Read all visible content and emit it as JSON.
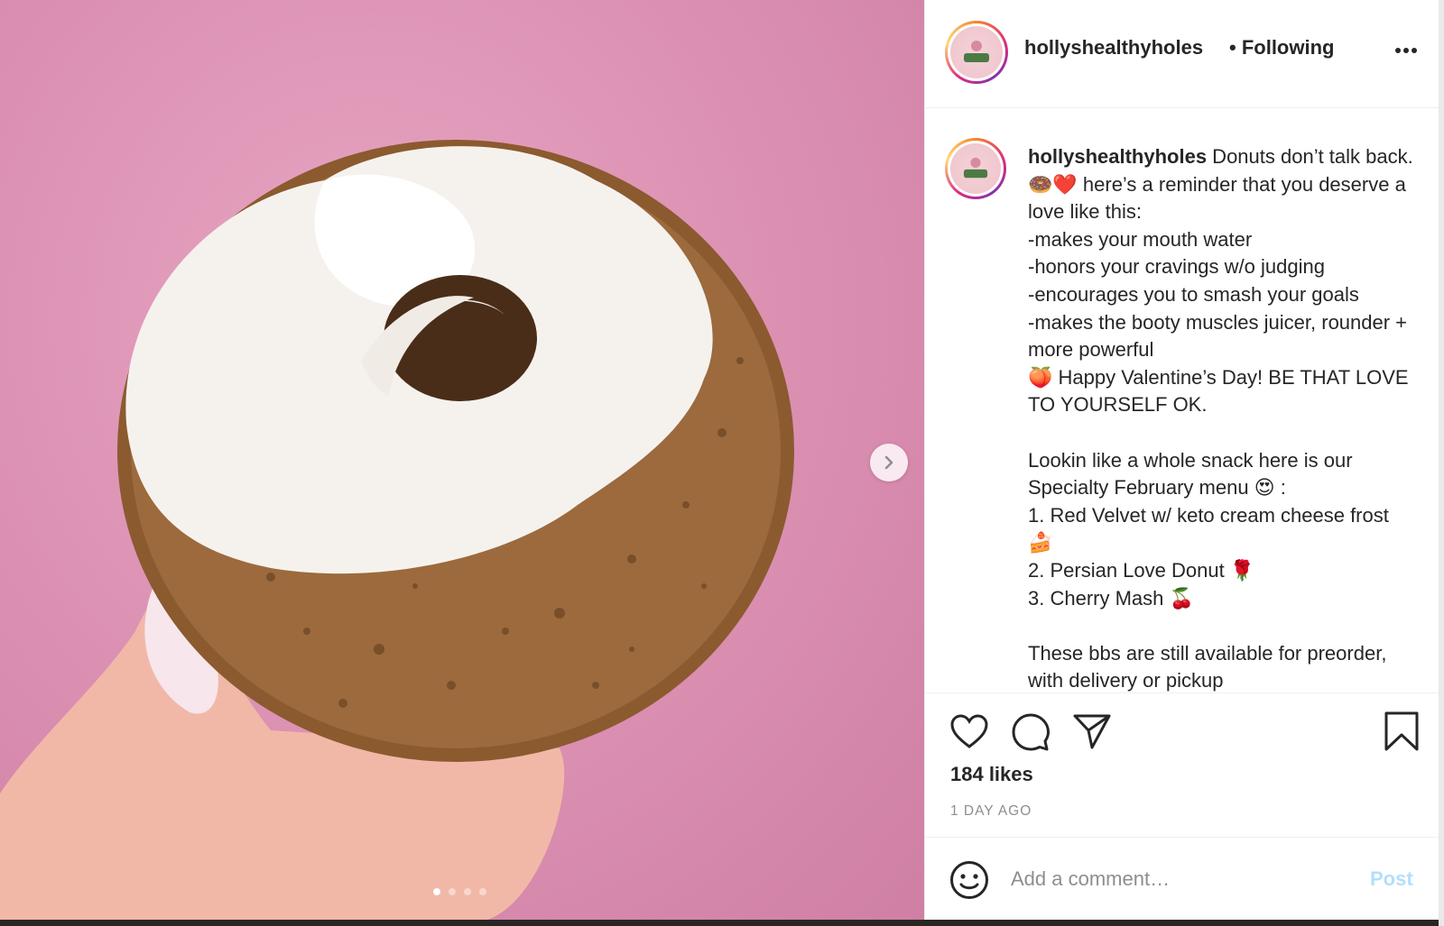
{
  "header": {
    "username": "hollyshealthyholes",
    "separator": "•",
    "follow_status": "Following",
    "more_icon": "more-horizontal-icon"
  },
  "media": {
    "image_description_icon": "donut-photo",
    "carousel": {
      "total": 4,
      "active": 1
    },
    "next_icon": "chevron-right-icon"
  },
  "caption": {
    "username": "hollyshealthyholes",
    "text": " Donuts don’t talk back. 🍩❤️ here’s a reminder that you deserve a love like this:\n-makes your mouth water\n-honors your cravings w/o judging\n-encourages you to smash your goals\n-makes the booty muscles juicer, rounder + more powerful\n🍑 Happy Valentine’s Day! BE THAT LOVE TO YOURSELF OK.\n\nLookin like a whole snack here is our Specialty February menu 😍 :\n1. Red Velvet w/ keto cream cheese frost 🍰\n2. Persian Love Donut 🌹\n3. Cherry Mash 🍒\n\nThese bbs are still available for preorder, with delivery or pickup"
  },
  "actions": {
    "like_icon": "heart-icon",
    "comment_icon": "comment-icon",
    "share_icon": "send-icon",
    "save_icon": "bookmark-icon",
    "likes": "184 likes",
    "time_ago": "1 DAY AGO"
  },
  "comment": {
    "emoji_icon": "smiley-icon",
    "placeholder": "Add a comment…",
    "post_label": "Post"
  },
  "colors": {
    "accent_post_disabled": "#b2dffc",
    "text_primary": "#262626",
    "text_secondary": "#8e8e8e",
    "media_background": "#dd93b4"
  }
}
